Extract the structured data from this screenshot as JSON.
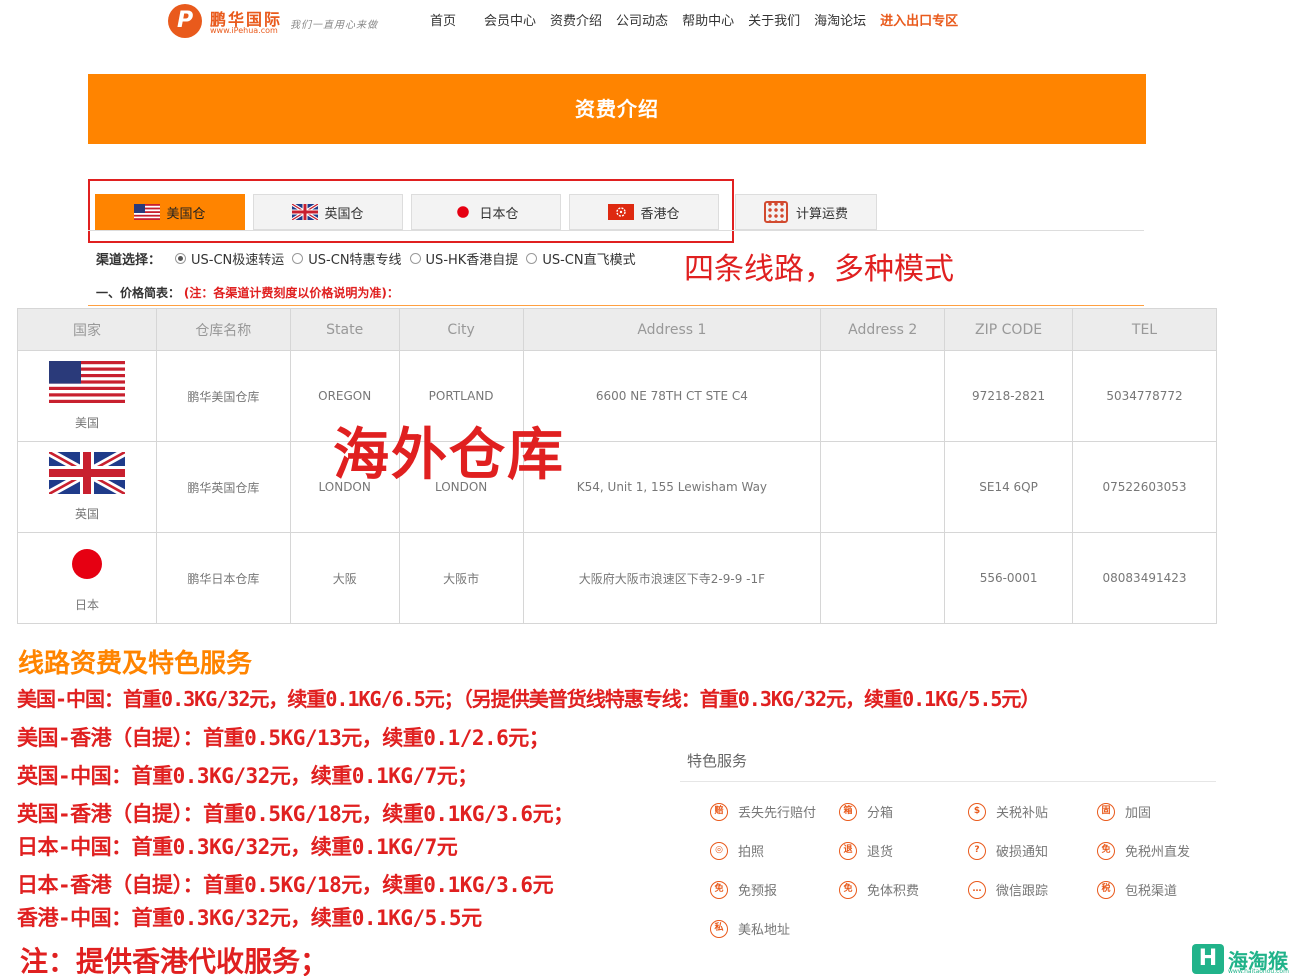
{
  "header": {
    "logo_mark": "P",
    "logo_name": "鹏华国际",
    "logo_url": "www.iPehua.com",
    "logo_slogan": "我们一直用心来做",
    "nav": [
      "首页",
      "会员中心",
      "资费介绍",
      "公司动态",
      "帮助中心",
      "关于我们",
      "海淘论坛",
      "进入出口专区"
    ]
  },
  "banner": {
    "title": "资费介绍"
  },
  "tabs": [
    {
      "label": "美国仓",
      "flag": "us-flag",
      "active": true
    },
    {
      "label": "英国仓",
      "flag": "uk-flag",
      "active": false
    },
    {
      "label": "日本仓",
      "flag": "jp-flag",
      "active": false
    },
    {
      "label": "香港仓",
      "flag": "hk-flag",
      "active": false
    },
    {
      "label": "计算运费",
      "icon": "calculator-icon",
      "active": false
    }
  ],
  "channels": {
    "label": "渠道选择：",
    "options": [
      "US-CN极速转运",
      "US-CN特惠专线",
      "US-HK香港自提",
      "US-CN直飞模式"
    ],
    "selected": "US-CN极速转运"
  },
  "annotations": {
    "routes": "四条线路，多种模式",
    "warehouse": "海外仓库"
  },
  "price_summary": {
    "label": "一、价格简表：",
    "note": "(注：各渠道计费刻度以价格说明为准)："
  },
  "warehouse_table": {
    "headers": [
      "国家",
      "仓库名称",
      "State",
      "City",
      "Address 1",
      "Address 2",
      "ZIP CODE",
      "TEL"
    ],
    "rows": [
      {
        "country": "美国",
        "flag": "us-flag",
        "name": "鹏华美国仓库",
        "state": "OREGON",
        "city": "PORTLAND",
        "address1": "6600 NE 78TH CT STE C4",
        "address2": "",
        "zip": "97218-2821",
        "tel": "5034778772"
      },
      {
        "country": "英国",
        "flag": "uk-flag",
        "name": "鹏华英国仓库",
        "state": "LONDON",
        "city": "LONDON",
        "address1": "K54, Unit 1, 155 Lewisham Way",
        "address2": "",
        "zip": "SE14 6QP",
        "tel": "07522603053"
      },
      {
        "country": "日本",
        "flag": "jp-flag",
        "name": "鹏华日本仓库",
        "state": "大阪",
        "city": "大阪市",
        "address1": "大阪府大阪市浪速区下寺2-9-9 -1F",
        "address2": "",
        "zip": "556-0001",
        "tel": "08083491423"
      }
    ]
  },
  "pricing": {
    "title": "线路资费及特色服务",
    "lines": [
      "美国-中国：首重0.3KG/32元，续重0.1KG/6.5元；（另提供美普货线特惠专线：首重0.3KG/32元，续重0.1KG/5.5元）",
      "美国-香港（自提）：首重0.5KG/13元，续重0.1/2.6元；",
      "英国-中国：首重0.3KG/32元，续重0.1KG/7元；",
      "英国-香港（自提）：首重0.5KG/18元，续重0.1KG/3.6元；",
      "日本-中国：首重0.3KG/32元，续重0.1KG/7元",
      "日本-香港（自提）：首重0.5KG/18元，续重0.1KG/3.6元",
      "香港-中国：首重0.3KG/32元，续重0.1KG/5.5元"
    ],
    "note": "注：提供香港代收服务；"
  },
  "services": {
    "title": "特色服务",
    "items": [
      {
        "label": "丢失先行赔付",
        "icon": "赔"
      },
      {
        "label": "分箱",
        "icon": "箱"
      },
      {
        "label": "关税补贴",
        "icon": "$"
      },
      {
        "label": "加固",
        "icon": "固"
      },
      {
        "label": "拍照",
        "icon": "◎"
      },
      {
        "label": "退货",
        "icon": "退"
      },
      {
        "label": "破损通知",
        "icon": "?"
      },
      {
        "label": "免税州直发",
        "icon": "免"
      },
      {
        "label": "免预报",
        "icon": "免"
      },
      {
        "label": "免体积费",
        "icon": "免"
      },
      {
        "label": "微信跟踪",
        "icon": "…"
      },
      {
        "label": "包税渠道",
        "icon": "税"
      },
      {
        "label": "美私地址",
        "icon": "私"
      }
    ]
  },
  "watermark": {
    "mark": "H",
    "text": "海淘猴",
    "url": "www.haitaohou.com"
  }
}
